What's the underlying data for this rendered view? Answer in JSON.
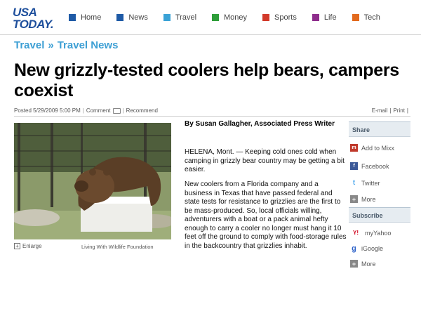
{
  "logo": {
    "line1": "USA",
    "line2": "TODAY."
  },
  "nav": [
    {
      "label": "Home",
      "color": "#1e5aa6"
    },
    {
      "label": "News",
      "color": "#1e5aa6"
    },
    {
      "label": "Travel",
      "color": "#3aa2d6"
    },
    {
      "label": "Money",
      "color": "#2e9e3a"
    },
    {
      "label": "Sports",
      "color": "#d23a2a"
    },
    {
      "label": "Life",
      "color": "#8e2d8c"
    },
    {
      "label": "Tech",
      "color": "#e26a1e"
    }
  ],
  "breadcrumb": {
    "section": "Travel",
    "separator": "»",
    "subsection": "Travel News"
  },
  "headline": "New grizzly-tested coolers help bears, campers coexist",
  "meta": {
    "posted": "Posted 5/29/2009 5:00 PM",
    "comment": "Comment",
    "recommend": "Recommend",
    "email": "E-mail",
    "print": "Print"
  },
  "photo": {
    "enlarge": "Enlarge",
    "credit": "Living With Wildlife Foundation"
  },
  "article": {
    "byline": "By Susan Gallagher, Associated Press Writer",
    "paragraph1": "HELENA, Mont. — Keeping cold ones cold when camping in grizzly bear country may be getting a bit easier.",
    "paragraph2": "New coolers from a Florida company and a business in Texas that have passed federal and state tests for resistance to grizzlies are the first to be mass-produced. So, local officials willing, adventurers with a boat or a pack animal hefty enough to carry a cooler no longer must hang it 10 feet off the ground to comply with food-storage rules in the backcountry that grizzlies inhabit."
  },
  "sidebar": {
    "share_title": "Share",
    "share_items": [
      {
        "label": "Add to Mixx",
        "icon": "mixx-icon"
      },
      {
        "label": "Facebook",
        "icon": "facebook-icon"
      },
      {
        "label": "Twitter",
        "icon": "twitter-icon"
      },
      {
        "label": "More",
        "icon": "plus-icon"
      }
    ],
    "subscribe_title": "Subscribe",
    "subscribe_items": [
      {
        "label": "myYahoo",
        "icon": "yahoo-icon"
      },
      {
        "label": "iGoogle",
        "icon": "google-icon"
      },
      {
        "label": "More",
        "icon": "plus-icon"
      }
    ]
  }
}
